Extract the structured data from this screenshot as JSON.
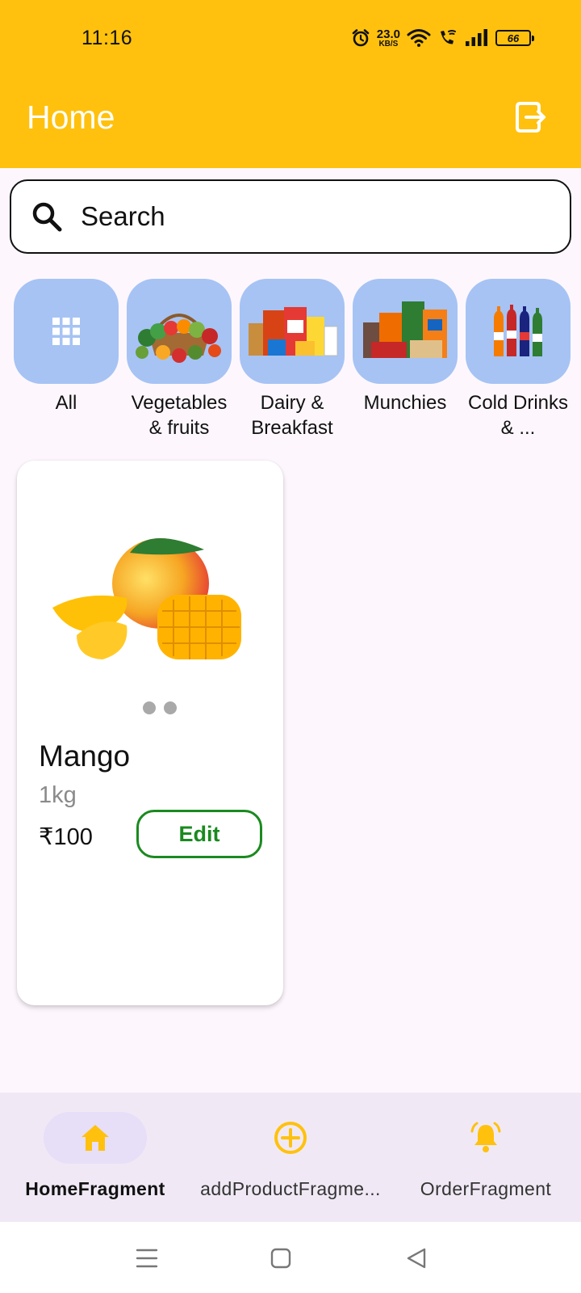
{
  "status_bar": {
    "time": "11:16",
    "net_speed_value": "23.0",
    "net_speed_unit": "KB/S",
    "battery": "66",
    "icons": [
      "alarm-icon",
      "wifi-icon",
      "wifi-call-icon",
      "signal-icon",
      "battery-icon"
    ]
  },
  "app_bar": {
    "title": "Home",
    "action_icon": "logout-icon"
  },
  "search": {
    "placeholder": "Search",
    "icon": "search-icon"
  },
  "categories": [
    {
      "label": "All",
      "icon": "grid-icon"
    },
    {
      "label": "Vegetables & fruits",
      "image": "vegetables-fruits-image"
    },
    {
      "label": "Dairy & Breakfast",
      "image": "dairy-breakfast-image"
    },
    {
      "label": "Munchies",
      "image": "munchies-image"
    },
    {
      "label": "Cold Drinks & ...",
      "image": "cold-drinks-image"
    }
  ],
  "products": [
    {
      "name": "Mango",
      "quantity": "1kg",
      "price": "₹100",
      "action_label": "Edit",
      "image": "mango-image",
      "image_count": 2
    }
  ],
  "bottom_nav": [
    {
      "label": "HomeFragment",
      "icon": "home-icon",
      "active": true
    },
    {
      "label": "addProductFragme...",
      "icon": "add-circle-icon",
      "active": false
    },
    {
      "label": "OrderFragment",
      "icon": "bell-icon",
      "active": false
    }
  ],
  "system_nav": [
    "menu-icon",
    "home-square-icon",
    "back-triangle-icon"
  ],
  "colors": {
    "primary": "#ffc10d",
    "category_tile": "#a6c3f4",
    "edit_green": "#1a8a1f",
    "nav_active_pill": "#e7def7",
    "background": "#fdf7fd"
  }
}
